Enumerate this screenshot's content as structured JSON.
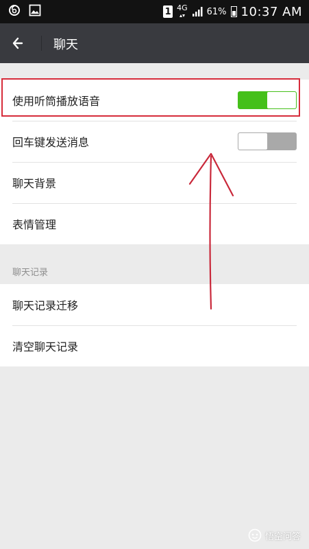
{
  "status_bar": {
    "sim_slot": "1",
    "network": "4G",
    "battery_percent": "61%",
    "battery_level": 0.61,
    "time": "10:37 AM"
  },
  "app_bar": {
    "back_icon": "arrow-left-icon",
    "title": "聊天"
  },
  "settings": {
    "group1": [
      {
        "label": "使用听筒播放语音",
        "toggle": "on"
      },
      {
        "label": "回车键发送消息",
        "toggle": "off"
      },
      {
        "label": "聊天背景"
      },
      {
        "label": "表情管理"
      }
    ],
    "section_chat_records": "聊天记录",
    "group2": [
      {
        "label": "聊天记录迁移"
      },
      {
        "label": "清空聊天记录"
      }
    ]
  },
  "colors": {
    "status_bar_bg": "#121212",
    "app_bar_bg": "#393a3f",
    "page_bg": "#ebebeb",
    "toggle_on": "#45c01a",
    "toggle_off": "#a9a9a9",
    "annotation_red": "#d62b3a"
  },
  "watermark": {
    "text": "悟空问答"
  }
}
